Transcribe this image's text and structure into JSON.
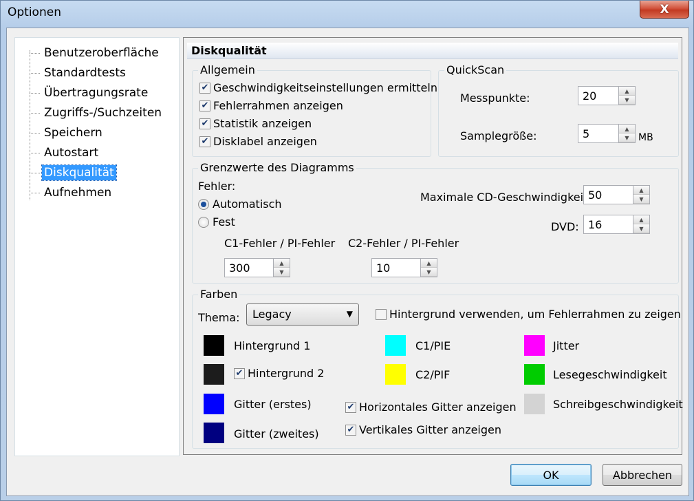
{
  "window": {
    "title": "Optionen",
    "close_glyph": "X"
  },
  "tree": {
    "items": [
      {
        "label": "Benutzeroberfläche",
        "selected": false
      },
      {
        "label": "Standardtests",
        "selected": false
      },
      {
        "label": "Übertragungsrate",
        "selected": false
      },
      {
        "label": "Zugriffs-/Suchzeiten",
        "selected": false
      },
      {
        "label": "Speichern",
        "selected": false
      },
      {
        "label": "Autostart",
        "selected": false
      },
      {
        "label": "Diskqualität",
        "selected": true
      },
      {
        "label": "Aufnehmen",
        "selected": false
      }
    ]
  },
  "panel": {
    "header": "Diskqualität",
    "allgemein": {
      "title": "Allgemein",
      "options": [
        {
          "label": "Geschwindigkeitseinstellungen ermitteln",
          "checked": true
        },
        {
          "label": "Fehlerrahmen anzeigen",
          "checked": true
        },
        {
          "label": "Statistik anzeigen",
          "checked": true
        },
        {
          "label": "Disklabel anzeigen",
          "checked": true
        }
      ]
    },
    "quickscan": {
      "title": "QuickScan",
      "messpunkte_label": "Messpunkte:",
      "messpunkte_value": "20",
      "samplegroesse_label": "Samplegröße:",
      "samplegroesse_value": "5",
      "samplegroesse_unit": "MB"
    },
    "grenzwerte": {
      "title": "Grenzwerte des Diagramms",
      "fehler_label": "Fehler:",
      "radio_auto": "Automatisch",
      "radio_fest": "Fest",
      "selected_radio": "Automatisch",
      "max_cd_label": "Maximale CD-Geschwindigkeit",
      "max_cd_value": "50",
      "dvd_label": "DVD:",
      "dvd_value": "16",
      "c1_label": "C1-Fehler / PI-Fehler",
      "c1_value": "300",
      "c2_label": "C2-Fehler / PI-Fehler",
      "c2_value": "10"
    },
    "farben": {
      "title": "Farben",
      "thema_label": "Thema:",
      "thema_value": "Legacy",
      "bg_errorframe_label": "Hintergrund verwenden, um Fehlerrahmen zu zeigen",
      "bg_errorframe_checked": false,
      "colors": {
        "hintergrund1": {
          "label": "Hintergrund 1",
          "color": "#000000"
        },
        "hintergrund2": {
          "label": "Hintergrund 2",
          "color": "#1c1c1c",
          "checked": true
        },
        "gitter1": {
          "label": "Gitter (erstes)",
          "color": "#0000ff"
        },
        "gitter2": {
          "label": "Gitter (zweites)",
          "color": "#000080"
        },
        "c1pie": {
          "label": "C1/PIE",
          "color": "#00ffff"
        },
        "c2pif": {
          "label": "C2/PIF",
          "color": "#ffff00"
        },
        "jitter": {
          "label": "Jitter",
          "color": "#ff00ff"
        },
        "lese": {
          "label": "Lesegeschwindigkeit",
          "color": "#00cc00"
        },
        "schreib": {
          "label": "Schreibgeschwindigkeit",
          "color": "#d3d3d3"
        }
      },
      "horiz_grid_label": "Horizontales Gitter anzeigen",
      "horiz_grid_checked": true,
      "vert_grid_label": "Vertikales Gitter anzeigen",
      "vert_grid_checked": true
    }
  },
  "buttons": {
    "ok": "OK",
    "cancel": "Abbrechen"
  }
}
